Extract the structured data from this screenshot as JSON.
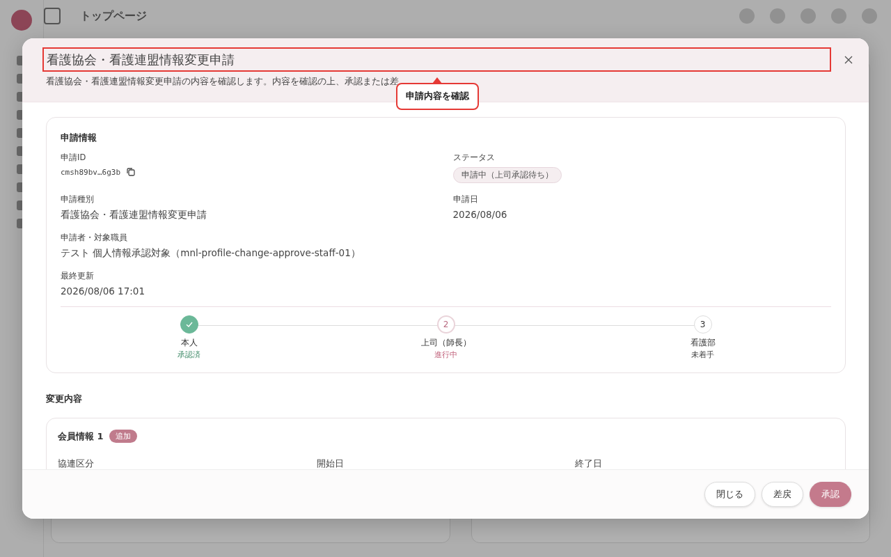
{
  "background_page": {
    "title": "トップページ"
  },
  "dialog": {
    "title": "看護協会・看護連盟情報変更申請",
    "description": "看護協会・看護連盟情報変更申請の内容を確認します。内容を確認の上、承認または差"
  },
  "tour": {
    "title_highlighted": true,
    "tooltip": "申請内容を確認"
  },
  "application_info": {
    "heading": "申請情報",
    "fields": [
      {
        "label": "申請ID",
        "value": "cmsh89bv…6g3b",
        "kind": "id"
      },
      {
        "label": "ステータス",
        "value": "申請中（上司承認待ち）",
        "kind": "status"
      },
      {
        "label": "申請種別",
        "value": "看護協会・看護連盟情報変更申請",
        "kind": "text"
      },
      {
        "label": "申請日",
        "value": "2026/08/06",
        "kind": "text"
      },
      {
        "label": "申請者・対象職員",
        "value": "テスト 個人情報承認対象（mnl-profile-change-approve-staff-01）",
        "kind": "wide"
      },
      {
        "label": "最終更新",
        "value": "2026/08/06 17:01",
        "kind": "wide"
      }
    ],
    "steps": [
      {
        "label": "本人",
        "state_text": "承認済",
        "completed": true,
        "current": false
      },
      {
        "number": "2",
        "label": "上司（師長）",
        "state_text": "進行中",
        "completed": false,
        "current": true
      },
      {
        "number": "3",
        "label": "看護部",
        "state_text": "未着手",
        "completed": false,
        "current": false
      }
    ]
  },
  "changes": {
    "heading": "変更内容",
    "sections": [
      {
        "title": "会員情報 1",
        "badge": "追加",
        "columns": [
          "協連区分",
          "開始日",
          "終了日"
        ]
      }
    ]
  },
  "buttons": [
    {
      "label": "閉じる",
      "kind": "secondary"
    },
    {
      "label": "差戻",
      "kind": "secondary"
    },
    {
      "label": "承認",
      "kind": "primary"
    }
  ]
}
